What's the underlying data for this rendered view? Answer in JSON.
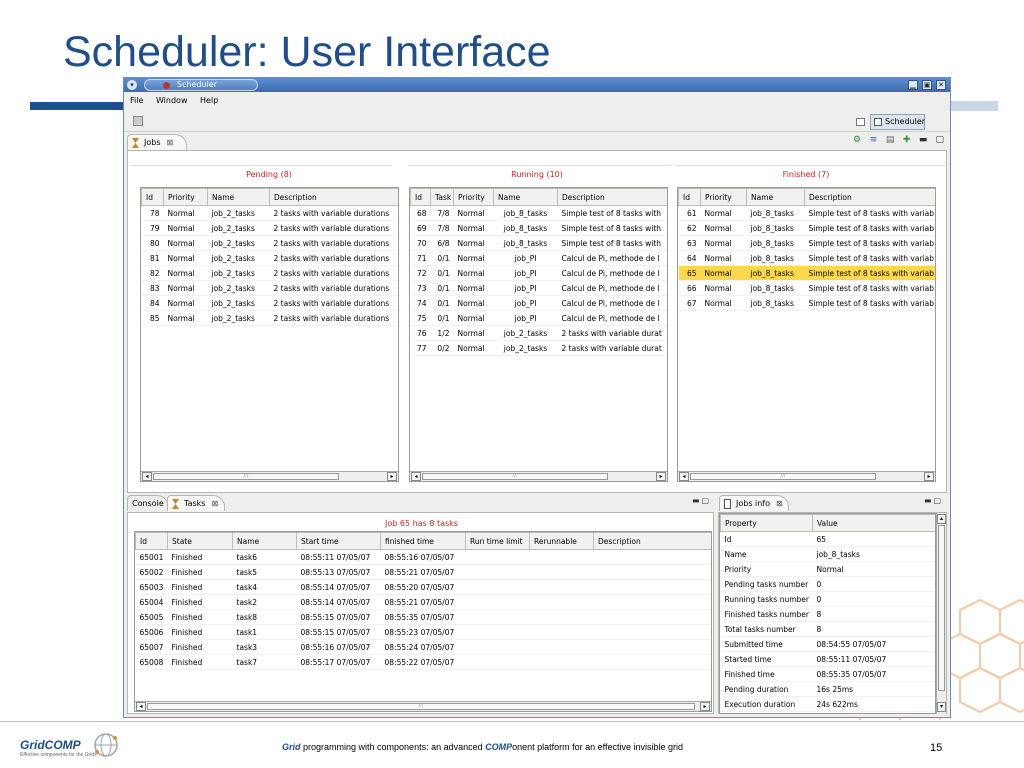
{
  "slide": {
    "title": "Scheduler: User Interface",
    "footer": {
      "logo": "GridCOMP",
      "logo_sub": "Effective components for the Grids",
      "text_pre_em": "Grid",
      "text_mid": " programming with components: an advanced ",
      "text_em2": "COMP",
      "text_post": "onent platform for an effective invisible grid",
      "page_number": "15"
    }
  },
  "window": {
    "title": "Scheduler",
    "menu": [
      "File",
      "Window",
      "Help"
    ],
    "perspective_label": "Scheduler",
    "colors": {
      "titlebar": "#3a6bb3",
      "selected_row": "#ffd84a",
      "group_title": "#d32020"
    }
  },
  "jobs_view": {
    "tab_label": "Jobs",
    "pending": {
      "title": "Pending (8)",
      "columns": [
        "Id",
        "Priority",
        "Name",
        "Description"
      ],
      "rows": [
        [
          "78",
          "Normal",
          "job_2_tasks",
          "2 tasks with variable durations"
        ],
        [
          "79",
          "Normal",
          "job_2_tasks",
          "2 tasks with variable durations"
        ],
        [
          "80",
          "Normal",
          "job_2_tasks",
          "2 tasks with variable durations"
        ],
        [
          "81",
          "Normal",
          "job_2_tasks",
          "2 tasks with variable durations"
        ],
        [
          "82",
          "Normal",
          "job_2_tasks",
          "2 tasks with variable durations"
        ],
        [
          "83",
          "Normal",
          "job_2_tasks",
          "2 tasks with variable durations"
        ],
        [
          "84",
          "Normal",
          "job_2_tasks",
          "2 tasks with variable durations"
        ],
        [
          "85",
          "Normal",
          "job_2_tasks",
          "2 tasks with variable durations"
        ]
      ]
    },
    "running": {
      "title": "Running (10)",
      "columns": [
        "Id",
        "Task",
        "Priority",
        "Name",
        "Description"
      ],
      "rows": [
        [
          "68",
          "7/8",
          "Normal",
          "job_8_tasks",
          "Simple test of 8 tasks with"
        ],
        [
          "69",
          "7/8",
          "Normal",
          "job_8_tasks",
          "Simple test of 8 tasks with"
        ],
        [
          "70",
          "6/8",
          "Normal",
          "job_8_tasks",
          "Simple test of 8 tasks with"
        ],
        [
          "71",
          "0/1",
          "Normal",
          "job_PI",
          "Calcul de Pi, methode de l"
        ],
        [
          "72",
          "0/1",
          "Normal",
          "job_PI",
          "Calcul de Pi, methode de l"
        ],
        [
          "73",
          "0/1",
          "Normal",
          "job_PI",
          "Calcul de Pi, methode de l"
        ],
        [
          "74",
          "0/1",
          "Normal",
          "job_PI",
          "Calcul de Pi, methode de l"
        ],
        [
          "75",
          "0/1",
          "Normal",
          "job_PI",
          "Calcul de Pi, methode de l"
        ],
        [
          "76",
          "1/2",
          "Normal",
          "job_2_tasks",
          "2 tasks with variable durat"
        ],
        [
          "77",
          "0/2",
          "Normal",
          "job_2_tasks",
          "2 tasks with variable durat"
        ]
      ]
    },
    "finished": {
      "title": "Finished (7)",
      "columns": [
        "Id",
        "Priority",
        "Name",
        "Description"
      ],
      "selected_index": 4,
      "rows": [
        [
          "61",
          "Normal",
          "job_8_tasks",
          "Simple test of 8 tasks with variab"
        ],
        [
          "62",
          "Normal",
          "job_8_tasks",
          "Simple test of 8 tasks with variab"
        ],
        [
          "63",
          "Normal",
          "job_8_tasks",
          "Simple test of 8 tasks with variab"
        ],
        [
          "64",
          "Normal",
          "job_8_tasks",
          "Simple test of 8 tasks with variab"
        ],
        [
          "65",
          "Normal",
          "job_8_tasks",
          "Simple test of 8 tasks with variab"
        ],
        [
          "66",
          "Normal",
          "job_8_tasks",
          "Simple test of 8 tasks with variab"
        ],
        [
          "67",
          "Normal",
          "job_8_tasks",
          "Simple test of 8 tasks with variab"
        ]
      ]
    }
  },
  "tasks_view": {
    "tabs": [
      "Console",
      "Tasks"
    ],
    "header": "Job 65 has 8 tasks",
    "columns": [
      "Id",
      "State",
      "Name",
      "Start time",
      "finished time",
      "Run time limit",
      "Rerunnable",
      "Description"
    ],
    "rows": [
      [
        "65001",
        "Finished",
        "task6",
        "08:55:11  07/05/07",
        "08:55:16  07/05/07",
        "",
        "",
        ""
      ],
      [
        "65002",
        "Finished",
        "task5",
        "08:55:13  07/05/07",
        "08:55:21  07/05/07",
        "",
        "",
        ""
      ],
      [
        "65003",
        "Finished",
        "task4",
        "08:55:14  07/05/07",
        "08:55:20  07/05/07",
        "",
        "",
        ""
      ],
      [
        "65004",
        "Finished",
        "task2",
        "08:55:14  07/05/07",
        "08:55:21  07/05/07",
        "",
        "",
        ""
      ],
      [
        "65005",
        "Finished",
        "task8",
        "08:55:15  07/05/07",
        "08:55:35  07/05/07",
        "",
        "",
        ""
      ],
      [
        "65006",
        "Finished",
        "task1",
        "08:55:15  07/05/07",
        "08:55:23  07/05/07",
        "",
        "",
        ""
      ],
      [
        "65007",
        "Finished",
        "task3",
        "08:55:16  07/05/07",
        "08:55:24  07/05/07",
        "",
        "",
        ""
      ],
      [
        "65008",
        "Finished",
        "task7",
        "08:55:17  07/05/07",
        "08:55:22  07/05/07",
        "",
        "",
        ""
      ]
    ]
  },
  "jobs_info": {
    "tab_label": "Jobs info",
    "columns": [
      "Property",
      "Value"
    ],
    "rows": [
      [
        "Id",
        "65"
      ],
      [
        "Name",
        "job_8_tasks"
      ],
      [
        "Priority",
        "Normal"
      ],
      [
        "Pending tasks number",
        "0"
      ],
      [
        "Running tasks number",
        "0"
      ],
      [
        "Finished tasks number",
        "8"
      ],
      [
        "Total tasks number",
        "8"
      ],
      [
        "Submitted time",
        "08:54:55  07/05/07"
      ],
      [
        "Started time",
        "08:55:11  07/05/07"
      ],
      [
        "Finished time",
        "08:55:35  07/05/07"
      ],
      [
        "Pending duration",
        "16s 25ms"
      ],
      [
        "Execution duration",
        "24s 622ms"
      ]
    ]
  }
}
